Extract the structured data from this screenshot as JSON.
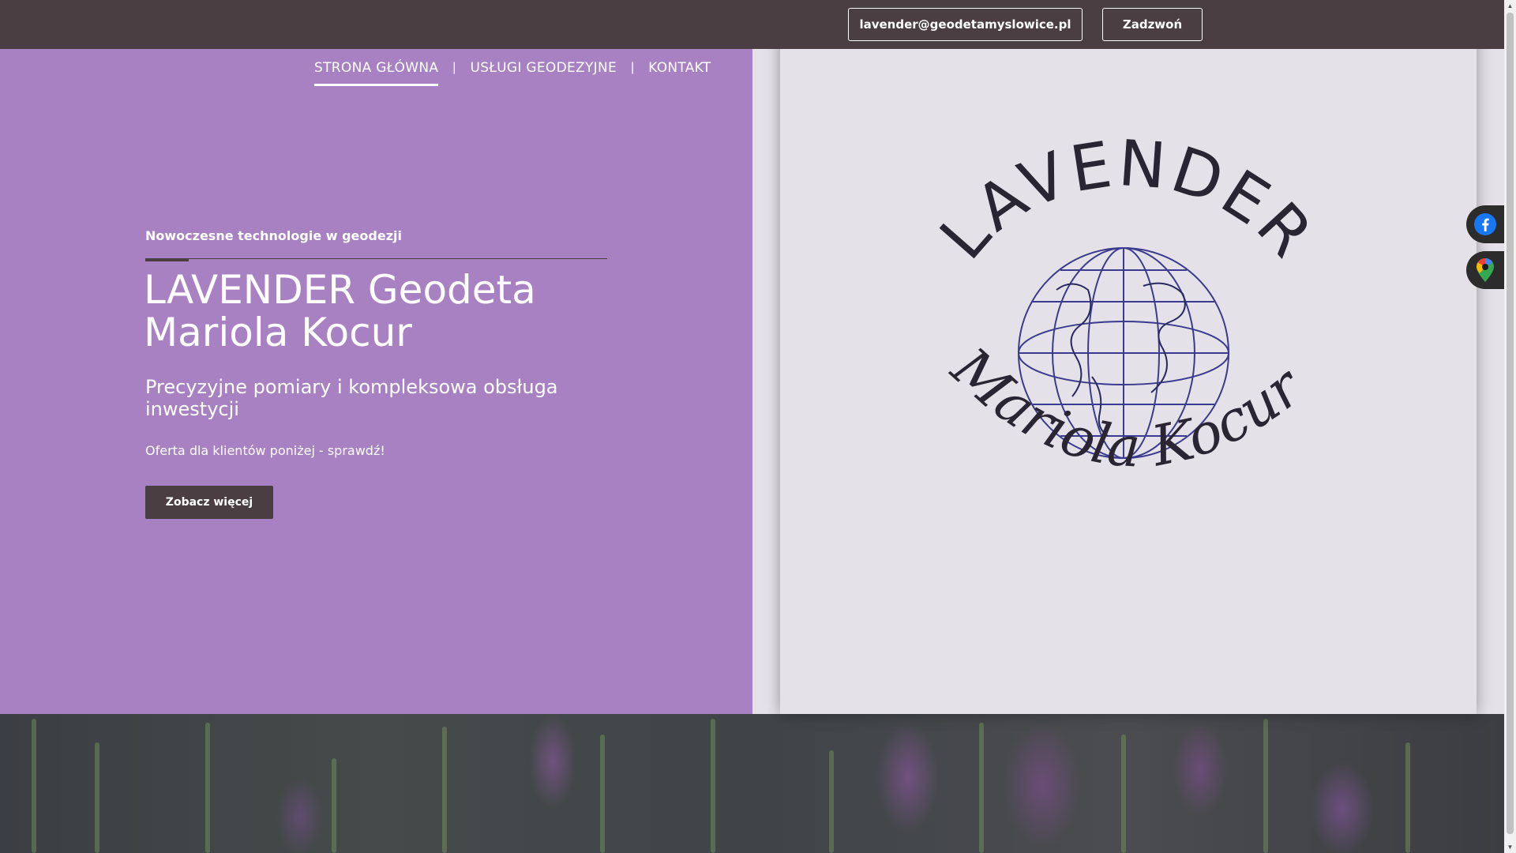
{
  "header": {
    "email_button": "lavender@geodetamyslowice.pl",
    "call_button": "Zadzwoń"
  },
  "nav": {
    "items": [
      {
        "label": "STRONA GŁÓWNA",
        "active": true
      },
      {
        "label": "USŁUGI GEODEZYJNE",
        "active": false
      },
      {
        "label": "KONTAKT",
        "active": false
      }
    ],
    "separator": "|"
  },
  "hero": {
    "kicker": "Nowoczesne technologie w geodezji",
    "title_line1": "LAVENDER Geodeta",
    "title_line2": "Mariola Kocur",
    "subtitle": "Precyzyjne pomiary i kompleksowa obsługa inwestycji",
    "offer": "Oferta dla klientów poniżej - sprawdź!",
    "cta": "Zobacz więcej"
  },
  "logo": {
    "arc_text": "LAVENDER",
    "script_text": "Mariola Kocur"
  },
  "social": {
    "facebook_icon": "facebook-icon",
    "maps_icon": "google-maps-icon"
  },
  "colors": {
    "topbar": "#4a3e42",
    "hero_purple": "#a881c3",
    "logo_bg": "#e4e2e8",
    "button_dark": "#4a3e42"
  }
}
